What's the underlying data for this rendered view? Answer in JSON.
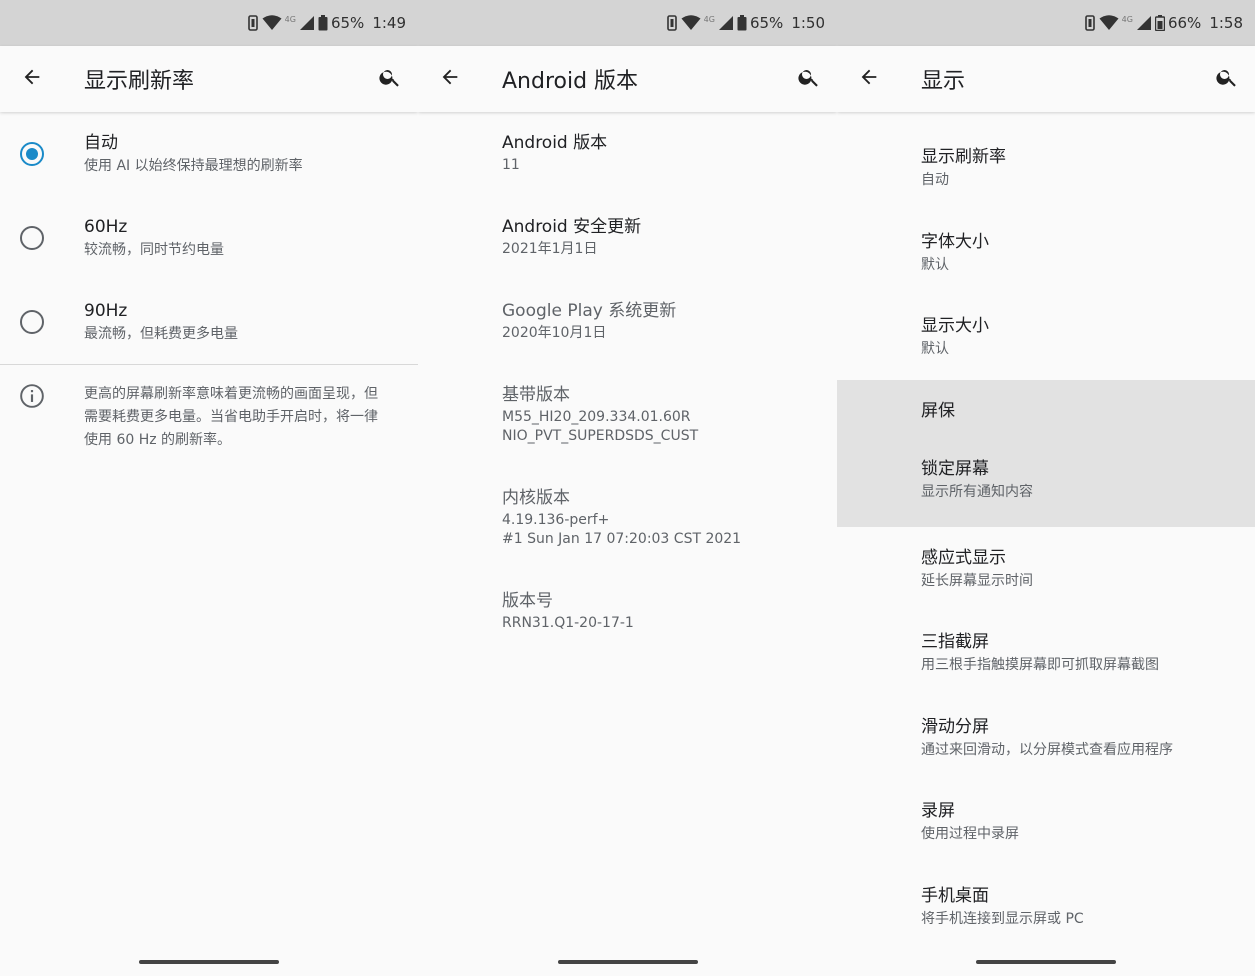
{
  "screens": [
    {
      "status": {
        "battery": "65%",
        "time": "1:49",
        "net": "4G"
      },
      "title": "显示刷新率",
      "options": [
        {
          "title": "自动",
          "subtitle": "使用 AI 以始终保持最理想的刷新率",
          "selected": true
        },
        {
          "title": "60Hz",
          "subtitle": "较流畅，同时节约电量",
          "selected": false
        },
        {
          "title": "90Hz",
          "subtitle": "最流畅，但耗费更多电量",
          "selected": false
        }
      ],
      "info": "更高的屏幕刷新率意味着更流畅的画面呈现，但需要耗费更多电量。当省电助手开启时，将一律使用 60 Hz 的刷新率。"
    },
    {
      "status": {
        "battery": "65%",
        "time": "1:50",
        "net": "4G"
      },
      "title": "Android 版本",
      "items": [
        {
          "title": "Android 版本",
          "lines": [
            "11"
          ]
        },
        {
          "title": "Android 安全更新",
          "lines": [
            "2021年1月1日"
          ]
        },
        {
          "title": "Google Play 系统更新",
          "lines": [
            "2020年10月1日"
          ]
        },
        {
          "title": "基带版本",
          "lines": [
            "M55_HI20_209.334.01.60R",
            "NIO_PVT_SUPERDSDS_CUST"
          ]
        },
        {
          "title": "内核版本",
          "lines": [
            "4.19.136-perf+",
            "#1 Sun Jan 17 07:20:03 CST 2021"
          ]
        },
        {
          "title": "版本号",
          "lines": [
            "RRN31.Q1-20-17-1"
          ]
        }
      ]
    },
    {
      "status": {
        "battery": "66%",
        "time": "1:58",
        "net": "4G"
      },
      "title": "显示",
      "items": [
        {
          "title": "显示刷新率",
          "subtitle": "自动"
        },
        {
          "title": "字体大小",
          "subtitle": "默认"
        },
        {
          "title": "显示大小",
          "subtitle": "默认"
        },
        {
          "title": "屏保",
          "subtitle": ""
        },
        {
          "title": "锁定屏幕",
          "subtitle": "显示所有通知内容"
        },
        {
          "title": "感应式显示",
          "subtitle": "延长屏幕显示时间"
        },
        {
          "title": "三指截屏",
          "subtitle": "用三根手指触摸屏幕即可抓取屏幕截图"
        },
        {
          "title": "滑动分屏",
          "subtitle": "通过来回滑动，以分屏模式查看应用程序"
        },
        {
          "title": "录屏",
          "subtitle": "使用过程中录屏"
        },
        {
          "title": "手机桌面",
          "subtitle": "将手机连接到显示屏或 PC"
        }
      ]
    }
  ],
  "colors": {
    "accent": "#1a8ac8",
    "statusbar": "#d4d4d4",
    "highlight": "#e2e2e2"
  },
  "icons": [
    "back-arrow-icon",
    "search-icon",
    "info-icon",
    "vibrate-icon",
    "wifi-icon",
    "signal-icon",
    "battery-icon"
  ]
}
